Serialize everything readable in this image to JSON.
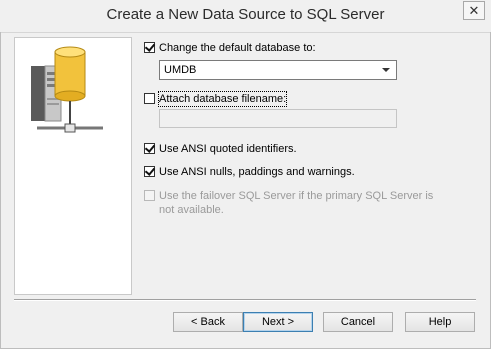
{
  "window": {
    "title": "Create a New Data Source to SQL Server",
    "close_glyph": "✕"
  },
  "options": {
    "change_db": {
      "label": "Change the default database to:",
      "checked": true
    },
    "database": {
      "value": "UMDB"
    },
    "attach_db": {
      "label": "Attach database filename:",
      "checked": false,
      "value": ""
    },
    "ansi_quoted": {
      "label": "Use ANSI quoted identifiers.",
      "checked": true
    },
    "ansi_nulls": {
      "label": "Use ANSI nulls, paddings and warnings.",
      "checked": true
    },
    "failover": {
      "label": "Use the failover SQL Server if the primary SQL Server is not available.",
      "checked": false,
      "enabled": false
    }
  },
  "buttons": {
    "back": "< Back",
    "next": "Next >",
    "cancel": "Cancel",
    "help": "Help"
  },
  "icons": {
    "art": "database-server-icon"
  }
}
